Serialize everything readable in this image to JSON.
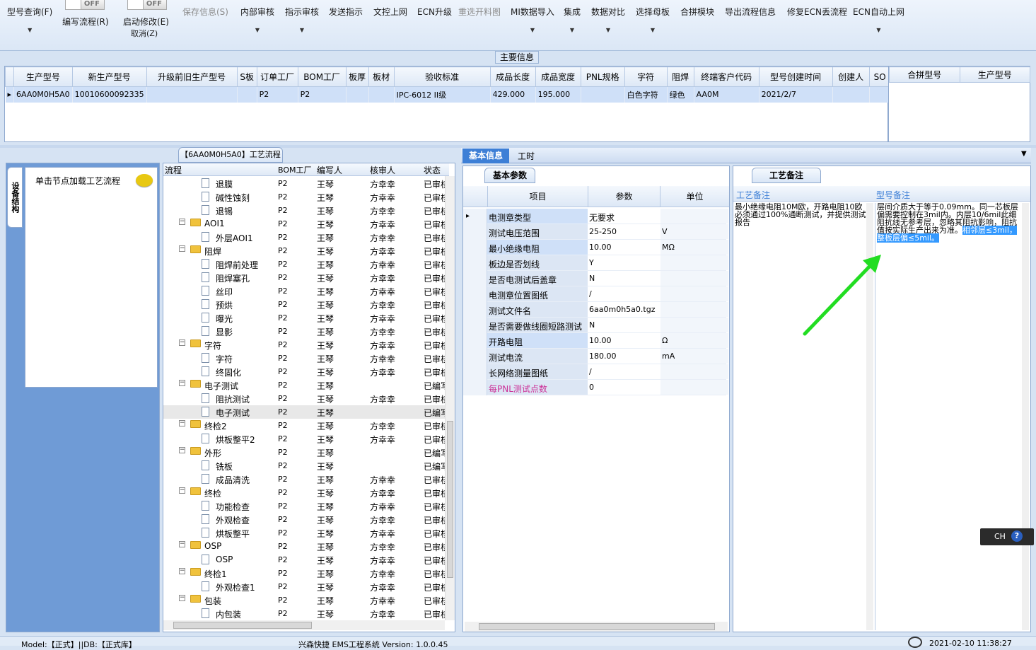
{
  "toolbar": {
    "query": "型号查询(F)",
    "write_flow": "编写流程(R)",
    "toggle1": "OFF",
    "toggle2": "OFF",
    "start_edit": "启动修改(E)",
    "cancel": "取消(Z)",
    "save": "保存信息(S)",
    "internal_review": "内部审核",
    "instruct_review": "指示审核",
    "send_instruct": "发送指示",
    "doc_upload": "文控上网",
    "ecn_upgrade": "ECN升级",
    "resend_chart": "重选开料图",
    "mi_import": "MI数据导入",
    "integrate": "集成",
    "data_compare": "数据对比",
    "select_mother": "选择母板",
    "merge_module": "合拼模块",
    "export_flow": "导出流程信息",
    "fix_ecn": "修复ECN丢流程",
    "ecn_auto": "ECN自动上网"
  },
  "main_info": {
    "label": "主要信息",
    "columns": [
      "生产型号",
      "新生产型号",
      "升级前旧生产型号",
      "S板",
      "订单工厂",
      "BOM工厂",
      "板厚",
      "板材",
      "验收标准",
      "成品长度",
      "成品宽度",
      "PNL规格",
      "字符",
      "阻焊",
      "终端客户代码",
      "型号创建时间",
      "创建人",
      "SO"
    ],
    "row": [
      "6AA0M0H5A0",
      "10010600092335",
      "",
      "",
      "P2",
      "P2",
      "",
      "",
      "IPC-6012 II级",
      "429.000",
      "195.000",
      "",
      "白色字符",
      "绿色",
      "AA0M",
      "2021/2/7",
      "",
      ""
    ],
    "side_columns": [
      "合拼型号",
      "生产型号"
    ]
  },
  "process": {
    "title": "【6AA0M0H5A0】工艺流程",
    "side_tab": "设备结构",
    "hint": "单击节点加载工艺流程",
    "columns": [
      "流程",
      "BOM工厂",
      "编写人",
      "核审人",
      "状态"
    ],
    "rows": [
      {
        "name": "退膜",
        "lvl": 2,
        "bom": "P2",
        "writer": "王琴",
        "reviewer": "方幸幸",
        "status": "已审核"
      },
      {
        "name": "碱性蚀刻",
        "lvl": 2,
        "bom": "P2",
        "writer": "王琴",
        "reviewer": "方幸幸",
        "status": "已审核"
      },
      {
        "name": "退锡",
        "lvl": 2,
        "bom": "P2",
        "writer": "王琴",
        "reviewer": "方幸幸",
        "status": "已审核"
      },
      {
        "name": "AOI1",
        "lvl": 1,
        "bom": "P2",
        "writer": "王琴",
        "reviewer": "方幸幸",
        "status": "已审核"
      },
      {
        "name": "外层AOI1",
        "lvl": 2,
        "bom": "P2",
        "writer": "王琴",
        "reviewer": "方幸幸",
        "status": "已审核"
      },
      {
        "name": "阻焊",
        "lvl": 1,
        "bom": "P2",
        "writer": "王琴",
        "reviewer": "方幸幸",
        "status": "已审核"
      },
      {
        "name": "阻焊前处理",
        "lvl": 2,
        "bom": "P2",
        "writer": "王琴",
        "reviewer": "方幸幸",
        "status": "已审核"
      },
      {
        "name": "阻焊塞孔",
        "lvl": 2,
        "bom": "P2",
        "writer": "王琴",
        "reviewer": "方幸幸",
        "status": "已审核"
      },
      {
        "name": "丝印",
        "lvl": 2,
        "bom": "P2",
        "writer": "王琴",
        "reviewer": "方幸幸",
        "status": "已审核"
      },
      {
        "name": "预烘",
        "lvl": 2,
        "bom": "P2",
        "writer": "王琴",
        "reviewer": "方幸幸",
        "status": "已审核"
      },
      {
        "name": "曝光",
        "lvl": 2,
        "bom": "P2",
        "writer": "王琴",
        "reviewer": "方幸幸",
        "status": "已审核"
      },
      {
        "name": "显影",
        "lvl": 2,
        "bom": "P2",
        "writer": "王琴",
        "reviewer": "方幸幸",
        "status": "已审核"
      },
      {
        "name": "字符",
        "lvl": 1,
        "bom": "P2",
        "writer": "王琴",
        "reviewer": "方幸幸",
        "status": "已审核"
      },
      {
        "name": "字符",
        "lvl": 2,
        "bom": "P2",
        "writer": "王琴",
        "reviewer": "方幸幸",
        "status": "已审核"
      },
      {
        "name": "终固化",
        "lvl": 2,
        "bom": "P2",
        "writer": "王琴",
        "reviewer": "方幸幸",
        "status": "已审核"
      },
      {
        "name": "电子测试",
        "lvl": 1,
        "bom": "P2",
        "writer": "王琴",
        "reviewer": "",
        "status": "已编写"
      },
      {
        "name": "阻抗测试",
        "lvl": 2,
        "bom": "P2",
        "writer": "王琴",
        "reviewer": "方幸幸",
        "status": "已审核"
      },
      {
        "name": "电子测试",
        "lvl": 2,
        "bom": "P2",
        "writer": "王琴",
        "reviewer": "",
        "status": "已编写"
      },
      {
        "name": "终检2",
        "lvl": 1,
        "bom": "P2",
        "writer": "王琴",
        "reviewer": "方幸幸",
        "status": "已审核"
      },
      {
        "name": "烘板整平2",
        "lvl": 2,
        "bom": "P2",
        "writer": "王琴",
        "reviewer": "方幸幸",
        "status": "已审核"
      },
      {
        "name": "外形",
        "lvl": 1,
        "bom": "P2",
        "writer": "王琴",
        "reviewer": "",
        "status": "已编写"
      },
      {
        "name": "铣板",
        "lvl": 2,
        "bom": "P2",
        "writer": "王琴",
        "reviewer": "",
        "status": "已编写"
      },
      {
        "name": "成品清洗",
        "lvl": 2,
        "bom": "P2",
        "writer": "王琴",
        "reviewer": "方幸幸",
        "status": "已审核"
      },
      {
        "name": "终检",
        "lvl": 1,
        "bom": "P2",
        "writer": "王琴",
        "reviewer": "方幸幸",
        "status": "已审核"
      },
      {
        "name": "功能检查",
        "lvl": 2,
        "bom": "P2",
        "writer": "王琴",
        "reviewer": "方幸幸",
        "status": "已审核"
      },
      {
        "name": "外观检查",
        "lvl": 2,
        "bom": "P2",
        "writer": "王琴",
        "reviewer": "方幸幸",
        "status": "已审核"
      },
      {
        "name": "烘板整平",
        "lvl": 2,
        "bom": "P2",
        "writer": "王琴",
        "reviewer": "方幸幸",
        "status": "已审核"
      },
      {
        "name": "OSP",
        "lvl": 1,
        "bom": "P2",
        "writer": "王琴",
        "reviewer": "方幸幸",
        "status": "已审核"
      },
      {
        "name": "OSP",
        "lvl": 2,
        "bom": "P2",
        "writer": "王琴",
        "reviewer": "方幸幸",
        "status": "已审核"
      },
      {
        "name": "终检1",
        "lvl": 1,
        "bom": "P2",
        "writer": "王琴",
        "reviewer": "方幸幸",
        "status": "已审核"
      },
      {
        "name": "外观检查1",
        "lvl": 2,
        "bom": "P2",
        "writer": "王琴",
        "reviewer": "方幸幸",
        "status": "已审核"
      },
      {
        "name": "包装",
        "lvl": 1,
        "bom": "P2",
        "writer": "王琴",
        "reviewer": "方幸幸",
        "status": "已审核"
      },
      {
        "name": "内包装",
        "lvl": 2,
        "bom": "P2",
        "writer": "王琴",
        "reviewer": "方幸幸",
        "status": "已审核"
      }
    ]
  },
  "detail": {
    "tab_basic": "基本信息",
    "tab_hours": "工时",
    "sub_tab": "基本参数",
    "columns": [
      "项目",
      "参数",
      "单位"
    ],
    "rows": [
      {
        "item": "电测章类型",
        "value": "无要求",
        "unit": ""
      },
      {
        "item": "测试电压范围",
        "value": "25-250",
        "unit": "V"
      },
      {
        "item": "最小绝缘电阻",
        "value": "10.00",
        "unit": "MΩ"
      },
      {
        "item": "板边是否划线",
        "value": "Y",
        "unit": ""
      },
      {
        "item": "是否电测试后盖章",
        "value": "N",
        "unit": ""
      },
      {
        "item": "电测章位置图纸",
        "value": "/",
        "unit": ""
      },
      {
        "item": "测试文件名",
        "value": "6aa0m0h5a0.tgz",
        "unit": ""
      },
      {
        "item": "是否需要做线圈短路测试",
        "value": "N",
        "unit": ""
      },
      {
        "item": "开路电阻",
        "value": "10.00",
        "unit": "Ω"
      },
      {
        "item": "测试电流",
        "value": "180.00",
        "unit": "mA"
      },
      {
        "item": "长网络测量图纸",
        "value": "/",
        "unit": ""
      },
      {
        "item": "每PNL测试点数",
        "value": "0",
        "unit": ""
      }
    ]
  },
  "notes": {
    "tab": "工艺备注",
    "col1": "工艺备注",
    "col2": "型号备注",
    "process_note": "最小绝缘电阻10M欧，开路电阻10欧\n必须通过100%通断测试，并提供测试报告",
    "model_note": "层间介质大于等于0.09mm。同一芯板层偏需要控制在3mil内。内层10/6mil此细阻抗线无参考层，忽略其阻抗影响，阻抗值按实际生产出来为准。",
    "model_note_sel": "相邻层≤3mil，整板层偏≤5mil。"
  },
  "ime": {
    "label": "CH",
    "help": "?"
  },
  "status": {
    "mode": "Model:【正式】||DB:【正式库】",
    "app": "兴森快捷 EMS工程系统 Version: 1.0.0.45",
    "time": "2021-02-10 11:38:27"
  },
  "colors": {
    "accent": "#3d7fd6",
    "arrow": "#22dd22",
    "selection": "#3399ff"
  }
}
